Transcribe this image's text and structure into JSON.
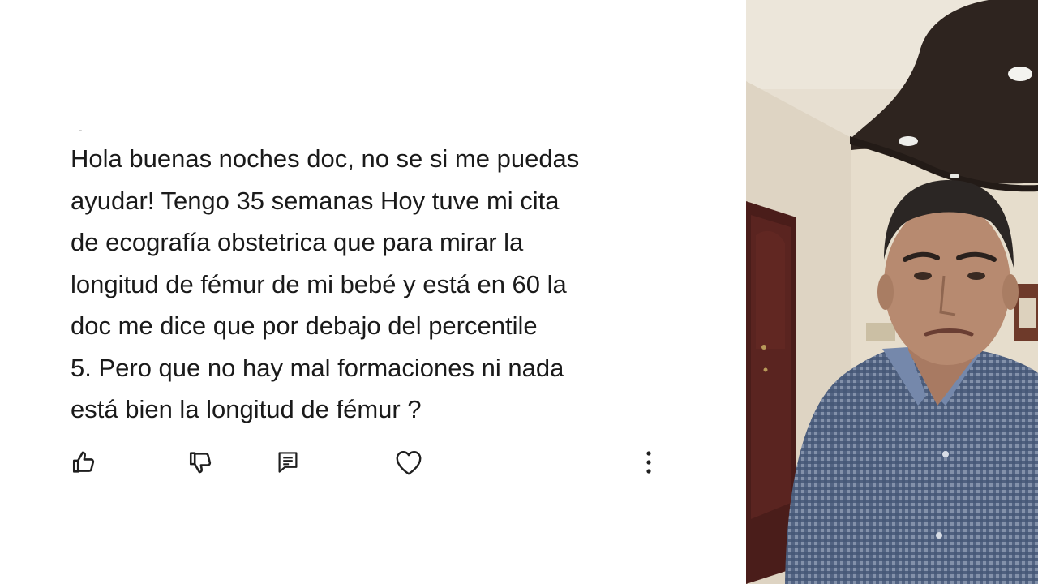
{
  "comment": {
    "lines": [
      "Hola buenas noches doc, no se si me puedas",
      "ayudar! Tengo 35 semanas Hoy tuve mi cita",
      "de ecografía obstetrica que para mirar la",
      "longitud de fémur de mi bebé y está en 60 la",
      "doc me dice que por debajo del percentile",
      "5. Pero que no hay mal formaciones ni nada",
      "está bien la longitud de fémur ?"
    ]
  },
  "actions": {
    "like_icon": "thumbs-up-icon",
    "dislike_icon": "thumbs-down-icon",
    "reply_icon": "comment-icon",
    "heart_icon": "heart-icon",
    "more_icon": "more-vertical-icon"
  },
  "colors": {
    "text": "#1a1a1a",
    "icon": "#1f1f1f",
    "background": "#ffffff"
  }
}
